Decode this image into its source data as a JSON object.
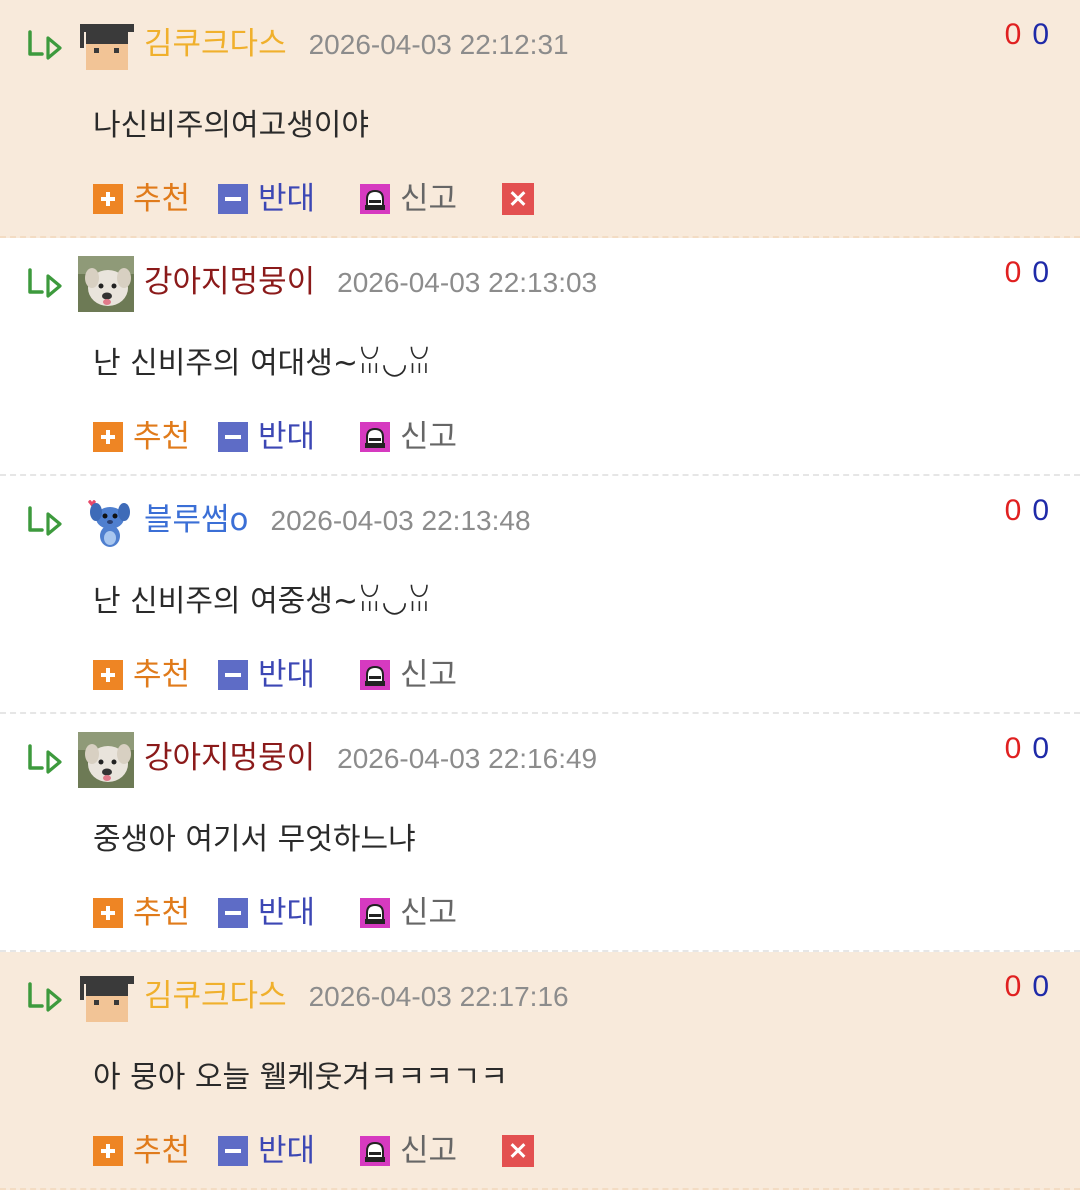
{
  "colors": {
    "mine_background": "#f8eadb",
    "up_count": "#e02020",
    "down_count": "#1f2aa8",
    "recommend": "#e07b1b",
    "oppose": "#3c47b4",
    "delete": "#e35050"
  },
  "actions": {
    "recommend_label": "추천",
    "oppose_label": "반대",
    "report_label": "신고"
  },
  "comments": [
    {
      "nickname": "김쿠크다스",
      "avatar": "graduation-cap-avatar",
      "date": "2026-04-03 22:12:31",
      "content": "나신비주의여고생이야",
      "up": "0",
      "down": "0",
      "deletable": true
    },
    {
      "nickname": "강아지멍뭉이",
      "avatar": "puppy-photo-avatar",
      "date": "2026-04-03 22:13:03",
      "content": "난 신비주의 여대생~ꈍ◡ꈍ",
      "up": "0",
      "down": "0",
      "deletable": false
    },
    {
      "nickname": "블루썸o",
      "avatar": "stitch-avatar",
      "date": "2026-04-03 22:13:48",
      "content": "난 신비주의 여중생~ꈍ◡ꈍ",
      "up": "0",
      "down": "0",
      "deletable": false
    },
    {
      "nickname": "강아지멍뭉이",
      "avatar": "puppy-photo-avatar",
      "date": "2026-04-03 22:16:49",
      "content": "중생아 여기서 무엇하느냐",
      "up": "0",
      "down": "0",
      "deletable": false
    },
    {
      "nickname": "김쿠크다스",
      "avatar": "graduation-cap-avatar",
      "date": "2026-04-03 22:17:16",
      "content": "아 뭉아 오늘 웰케웃겨ㅋㅋㅋㄱㅋ",
      "up": "0",
      "down": "0",
      "deletable": true
    }
  ]
}
